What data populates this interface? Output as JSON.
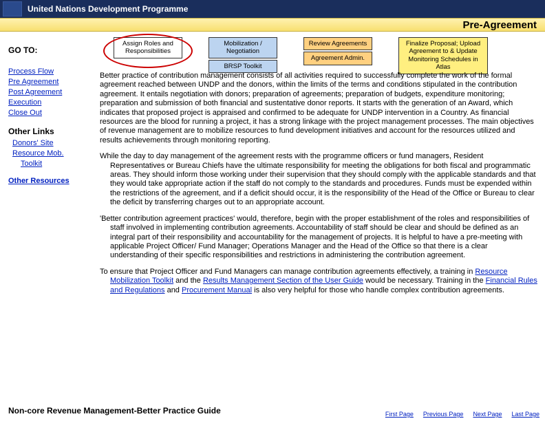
{
  "header": {
    "org": "United Nations Development Programme",
    "title": "Pre-Agreement"
  },
  "nav": {
    "goto": "GO TO:",
    "links": {
      "process_flow": "Process Flow",
      "pre_agreement": "Pre Agreement",
      "post_agreement": "Post Agreement",
      "execution": "Execution",
      "close_out": "Close Out"
    },
    "other_links": "Other Links",
    "donors_site": "Donors' Site",
    "resource_mob": "Resource Mob.",
    "toolkit": "Toolkit",
    "other_resources": "Other Resources"
  },
  "flow": {
    "assign": "Assign Roles and Responsibilities",
    "mobilization": "Mobilization / Negotiation",
    "brsp": "BRSP Toolkit",
    "review": "Review Agreements",
    "admin": "Agreement Admin.",
    "finalize": "Finalize Proposal; Upload Agreement to & Update Monitoring Schedules in Atlas"
  },
  "body": {
    "p1a": "Better practice of contribution management consists of all activities required to successfully complete the work of the formal agreement reached between UNDP and the donors, within the limits of the terms and conditions stipulated in the contribution agreement. It entails negotiation with donors; preparation of agreements; preparation of budgets, expenditure monitoring; preparation and submission of both financial and sustentative donor reports. It starts with the generation of an Award, which indicates that proposed project  is appraised and confirmed to be adequate for UNDP intervention in a Country. As financial resources are the blood for running a project, it has a strong linkage with the project management processes.  The main objectives of revenue management are to mobilize resources to fund development initiatives and account for the resources utilized and results achievements through monitoring reporting.",
    "p2a": "While the day to day management of the agreement rests with the programme officers or fund managers, Resident Representatives or Bureau Chiefs have the ultimate responsibility for meeting the obligations for both fiscal and programmatic areas.   They should inform those working under their supervision that they should comply with the applicable standards and that they would take appropriate action if the staff do not comply to the standards and procedures. Funds must be expended within the restrictions of the agreement, and if a deficit should occur, it is the responsibility of the Head of the Office or Bureau to clear the deficit by transferring charges out to an appropriate account.",
    "p3a": "'Better contribution agreement practices'  would, therefore, begin with the proper establishment of the roles and responsibilities of staff involved in implementing contribution agreements.   Accountability of staff should be clear and should be defined as an integral part of their responsibility and accountability for the management of projects.   It is helpful to have a pre-meeting with applicable Project Officer/ Fund Manager; Operations Manager and the Head of the Office so that there is a clear understanding of their specific responsibilities and restrictions in administering the contribution agreement.",
    "p4a": "To ensure that Project Officer and Fund Managers can  manage contribution agreements effectively, a training in ",
    "p4link1": "Resource Mobilization Toolkit",
    "p4b": " and the ",
    "p4link2": "Results Management Section of the User Guide",
    "p4c": " would be necessary.  Training in the ",
    "p4link3": "Financial Rules and Regulations",
    "p4d": " and ",
    "p4link4": "Procurement Manual",
    "p4e": " is also very helpful for those who handle complex contribution agreements."
  },
  "footer": {
    "title": "Non-core Revenue Management-Better Practice Guide",
    "first": "First Page",
    "prev": "Previous Page",
    "next": "Next Page",
    "last": "Last Page"
  }
}
